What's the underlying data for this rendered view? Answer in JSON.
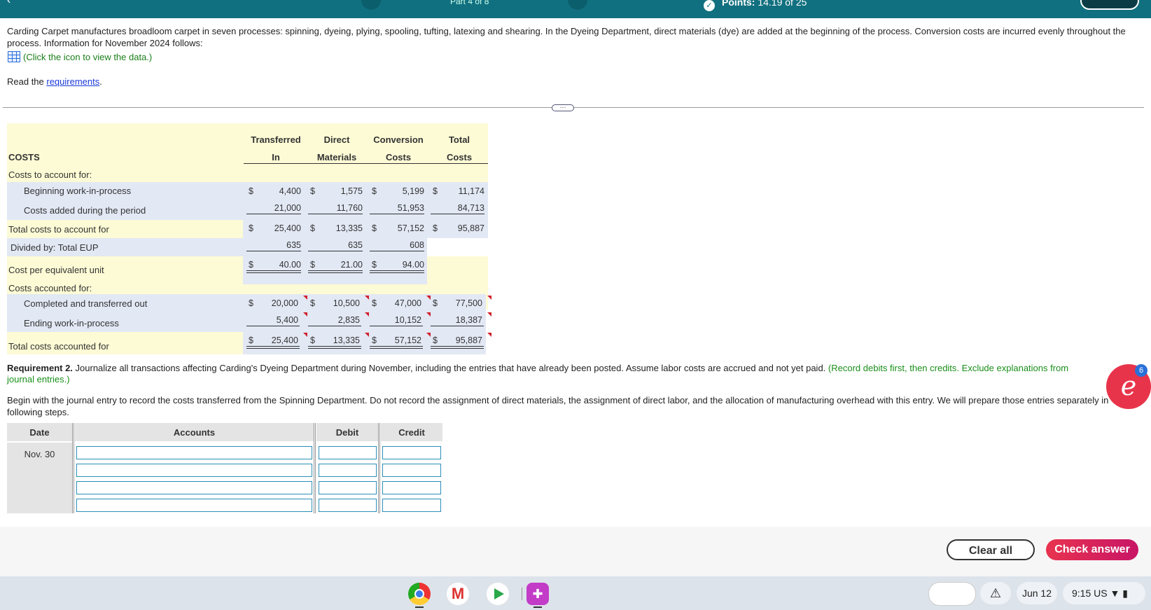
{
  "header": {
    "part": "Part 4 of 8",
    "points_label": "Points:",
    "points_value": "14.19 of 25"
  },
  "intro": {
    "text": "Carding Carpet manufactures broadloom carpet in seven processes: spinning, dyeing, plying, spooling, tufting, latexing and shearing. In the Dyeing Department, direct materials (dye) are added at the beginning of the process. Conversion costs are incurred evenly throughout the process. Information for November 2024 follows:",
    "click_text": "(Click the icon to view the data.)",
    "read_prefix": "Read the ",
    "read_link": "requirements",
    "read_suffix": "."
  },
  "costs_table": {
    "title": "COSTS",
    "headers": [
      {
        "l1": "Transferred",
        "l2": "In"
      },
      {
        "l1": "Direct",
        "l2": "Materials"
      },
      {
        "l1": "Conversion",
        "l2": "Costs"
      },
      {
        "l1": "Total",
        "l2": "Costs"
      }
    ],
    "labels": {
      "to_account": "Costs to account for:",
      "bwip": "Beginning work-in-process",
      "added": "Costs added during the period",
      "total_to_account": "Total costs to account for",
      "divided": "Divided by: Total EUP",
      "cpu": "Cost per equivalent unit",
      "accounted": "Costs accounted for:",
      "completed": "Completed and transferred out",
      "ewip": "Ending work-in-process",
      "total_accounted": "Total costs accounted for"
    },
    "currency": "$",
    "bwip": [
      "4,400",
      "1,575",
      "5,199",
      "11,174"
    ],
    "added": [
      "21,000",
      "11,760",
      "51,953",
      "84,713"
    ],
    "total_to_account": [
      "25,400",
      "13,335",
      "57,152",
      "95,887"
    ],
    "eup": [
      "635",
      "635",
      "608"
    ],
    "cpu": [
      "40.00",
      "21.00",
      "94.00"
    ],
    "completed": [
      "20,000",
      "10,500",
      "47,000",
      "77,500"
    ],
    "ewip": [
      "5,400",
      "2,835",
      "10,152",
      "18,387"
    ],
    "total_accounted": [
      "25,400",
      "13,335",
      "57,152",
      "95,887"
    ]
  },
  "requirement2": {
    "label": "Requirement 2.",
    "text": " Journalize all transactions affecting Carding's Dyeing Department during November, including the entries that have already been posted. Assume labor costs are accrued and not yet paid. ",
    "hint": "(Record debits first, then credits. Exclude explanations from journal entries.)"
  },
  "begin_text": "Begin with the journal entry to record the costs transferred from the Spinning Department. Do not record the assignment of direct materials, the assignment of direct labor, and the allocation of manufacturing overhead with this entry. We will prepare those entries separately in following steps.",
  "journal": {
    "headers": {
      "date": "Date",
      "accounts": "Accounts",
      "debit": "Debit",
      "credit": "Credit"
    },
    "date": "Nov. 30",
    "rows": [
      {
        "account": "",
        "debit": "",
        "credit": ""
      },
      {
        "account": "",
        "debit": "",
        "credit": ""
      },
      {
        "account": "",
        "debit": "",
        "credit": ""
      },
      {
        "account": "",
        "debit": "",
        "credit": ""
      }
    ]
  },
  "buttons": {
    "clear_all": "Clear all",
    "check_answer": "Check answer"
  },
  "chat_badge": "6",
  "taskbar": {
    "date": "Jun 12",
    "time": "9:15",
    "locale": "US"
  }
}
